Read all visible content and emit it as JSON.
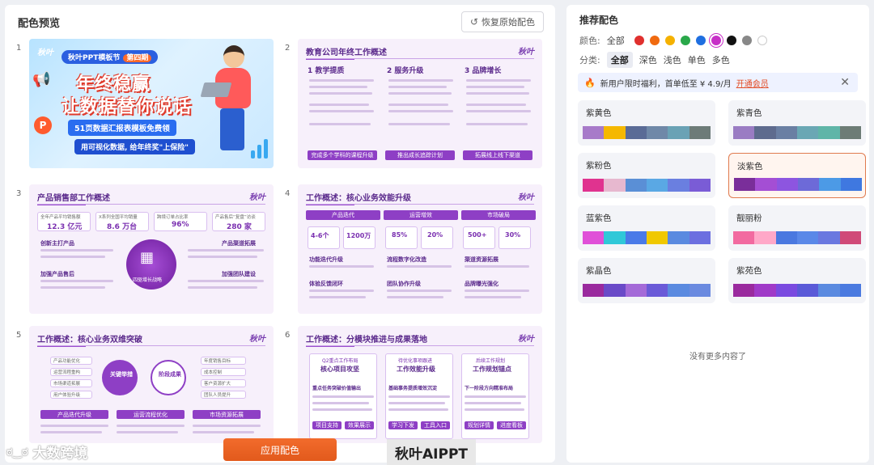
{
  "left": {
    "title": "配色预览",
    "restore_label": "恢复原始配色",
    "apply_label": "应用配色"
  },
  "watermarks": {
    "left": "大数跨境",
    "right": "秋叶AIPPT"
  },
  "slides": [
    {
      "num": "1",
      "logo": "秋叶",
      "badge": "秋叶PPT模板节",
      "badge_tag": "第四期",
      "line1": "年终稳赢",
      "line2": "让数据替你说话",
      "sub1": "51页数据汇报表模板免费领",
      "sub2": "用可视化数据, 给年终奖\"上保险\""
    },
    {
      "num": "2",
      "title": "教育公司年终工作概述",
      "logo": "秋叶",
      "cols": [
        "教学提质",
        "服务升级",
        "品牌增长"
      ],
      "footers": [
        "完成多个学科的课程升级",
        "推出成长追踪计划",
        "拓展线上线下渠道"
      ]
    },
    {
      "num": "3",
      "title": "产品销售部工作概述",
      "logo": "秋叶",
      "stats_labels": [
        "全年产品平均销售额",
        "X系列全国平均销量",
        "跨境订单占比率",
        "产品售后“复盘”访谈"
      ],
      "stats_values": [
        "12.3 亿元",
        "8.6 万台",
        "96%",
        "280 家"
      ],
      "sections": [
        "创新主打产品",
        "产品渠道拓展",
        "加强产品售后",
        "加强团队建设"
      ],
      "center": "四驱增长战略"
    },
    {
      "num": "4",
      "title": "工作概述：核心业务效能升级",
      "logo": "秋叶",
      "steps": [
        "产品迭代",
        "运营增效",
        "市场破局"
      ],
      "stats": [
        "4-6个",
        "1200万",
        "85%",
        "20%",
        "500+",
        "30%"
      ],
      "items": [
        "功能迭代升级",
        "流程数字化改造",
        "渠道资源拓展",
        "体验反馈闭环",
        "团队协作升级",
        "品牌曝光强化"
      ]
    },
    {
      "num": "5",
      "title": "工作概述：核心业务双维突破",
      "logo": "秋叶",
      "circles": [
        "关键举措",
        "阶段成果"
      ],
      "left_items": [
        "产品功能优化",
        "运营流程重构",
        "市场渠道拓展",
        "用户体验升级"
      ],
      "right_items": [
        "年度销售目标",
        "成本控制",
        "客户资源扩大",
        "团队人员提升"
      ],
      "bottom": [
        "产品迭代升级",
        "运营流程优化",
        "市场资源拓展"
      ]
    },
    {
      "num": "6",
      "title": "工作概述：分模块推进与成果落地",
      "logo": "秋叶",
      "cards": [
        "Q2重点工作布局",
        "待优化事项跟进",
        "后续工作规划"
      ],
      "card_subs": [
        "核心项目攻坚",
        "工作效能升级",
        "工作规划锚点"
      ],
      "card_items": [
        "重点任务突破价值输出",
        "基础事务提质增效沉淀",
        "下一阶段方向精准布局"
      ],
      "buttons": [
        "项目支持",
        "效果展示",
        "学习下发",
        "工具入口",
        "规划详情",
        "进度看板"
      ]
    }
  ],
  "right": {
    "title": "推荐配色",
    "color_label": "颜色:",
    "color_all": "全部",
    "colors": [
      "#e0302e",
      "#f06a10",
      "#f5b100",
      "#2aa84a",
      "#1f6fe0",
      "#c72fc7",
      "#111111",
      "#888888",
      "#ffffff"
    ],
    "category_label": "分类:",
    "categories": [
      "全部",
      "深色",
      "浅色",
      "单色",
      "多色"
    ],
    "promo_text": "新用户限时福利，首单低至 ¥ 4.9/月",
    "promo_link": "开通会员",
    "empty_text": "没有更多内容了",
    "palettes": [
      {
        "name": "紫黄色",
        "colors": [
          "#a77ac9",
          "#f5b800",
          "#5a6b96",
          "#6f88a8",
          "#6aa2b5",
          "#6d7b78"
        ]
      },
      {
        "name": "紫青色",
        "colors": [
          "#9a7cc3",
          "#5e6b8e",
          "#6a7fa3",
          "#6aa7b4",
          "#5fb5a8",
          "#6d7c76"
        ]
      },
      {
        "name": "紫粉色",
        "colors": [
          "#e0338f",
          "#e7b8cf",
          "#5a8fd6",
          "#5aa8e4",
          "#6a7fe0",
          "#7a5cd6"
        ]
      },
      {
        "name": "淡紫色",
        "colors": [
          "#7a2e9a",
          "#a44ed4",
          "#8d55e0",
          "#6d6ad8",
          "#4c9ae6",
          "#3f78e0"
        ]
      },
      {
        "name": "蓝紫色",
        "colors": [
          "#e050d8",
          "#30c8d8",
          "#4a7ae8",
          "#f0c800",
          "#5a8ae0",
          "#6c6fe0"
        ]
      },
      {
        "name": "靓丽粉",
        "colors": [
          "#f26aa0",
          "#ffa8c8",
          "#4a78e0",
          "#5a88e8",
          "#6a78e0",
          "#d04a78"
        ]
      },
      {
        "name": "紫晶色",
        "colors": [
          "#9a2a9e",
          "#6a4ac8",
          "#a46ad8",
          "#6a5ad8",
          "#5a8ae0",
          "#6a8ae0"
        ]
      },
      {
        "name": "紫苑色",
        "colors": [
          "#9a2a9e",
          "#a03ac8",
          "#7a4ae0",
          "#5a5ad8",
          "#5a8ae0",
          "#4a7ae0"
        ]
      }
    ]
  }
}
